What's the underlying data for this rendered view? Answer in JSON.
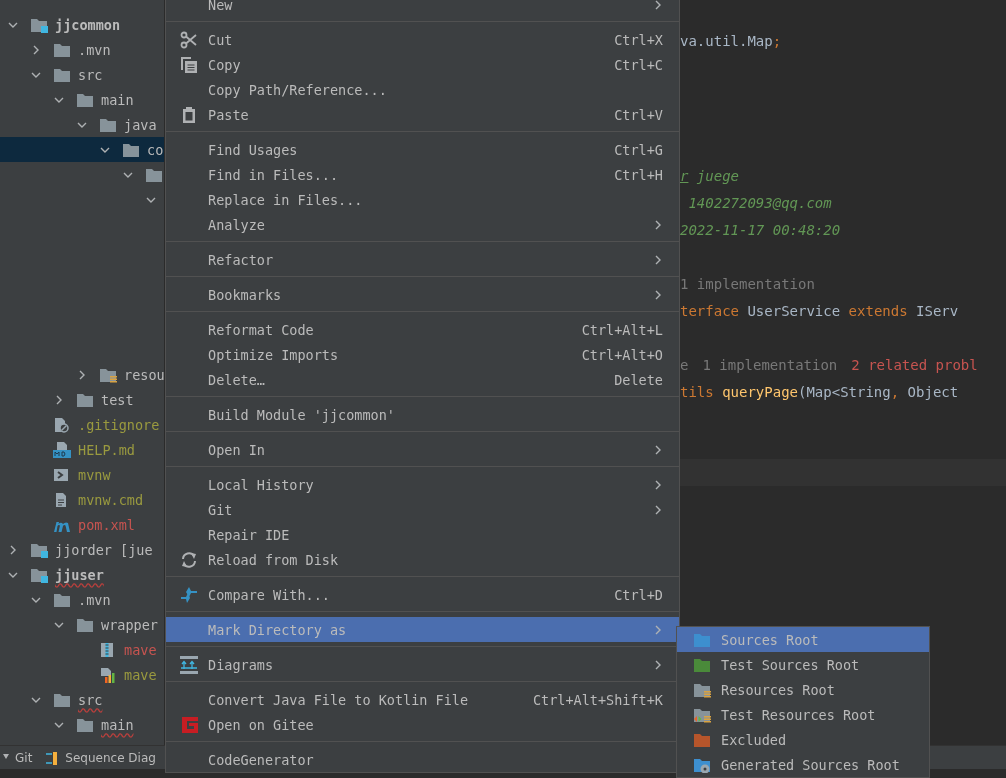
{
  "tree": [
    {
      "label": "jjcommon",
      "kind": "module",
      "bold": true,
      "expanded": true,
      "selected": false,
      "has_errors": false,
      "children": [
        {
          "label": ".mvn",
          "kind": "folder",
          "expanded": false,
          "selected": false,
          "has_errors": false
        },
        {
          "label": "src",
          "kind": "folder",
          "expanded": true,
          "selected": false,
          "has_errors": false,
          "children": [
            {
              "label": "main",
              "kind": "folder",
              "expanded": true,
              "selected": false,
              "has_errors": false,
              "children": [
                {
                  "label": "java",
                  "kind": "folder",
                  "expanded": true,
                  "selected": false,
                  "has_errors": false,
                  "children": [
                    {
                      "label": "co",
                      "kind": "folder",
                      "expanded": true,
                      "selected": true,
                      "children": [
                        {
                          "kind": "folder",
                          "expanded": true,
                          "selected": false,
                          "children": [
                            {
                              "expanded": true,
                              "selected": false
                            }
                          ]
                        }
                      ]
                    }
                  ]
                },
                {
                  "label": "resou",
                  "kind": "resources",
                  "expanded": false,
                  "selected": false,
                  "has_errors": false
                }
              ]
            },
            {
              "label": "test",
              "kind": "folder",
              "expanded": false,
              "selected": false,
              "has_errors": false
            }
          ]
        },
        {
          "label": ".gitignore",
          "kind": "ignore-file",
          "color": "#9a9a3f",
          "selected": false,
          "has_errors": false
        },
        {
          "label": "HELP.md",
          "kind": "markdown",
          "color": "#9a9a3f",
          "selected": false,
          "has_errors": false
        },
        {
          "label": "mvnw",
          "kind": "script",
          "color": "#9a9a3f",
          "selected": false,
          "has_errors": false
        },
        {
          "label": "mvnw.cmd",
          "kind": "text-file",
          "color": "#9a9a3f",
          "selected": false,
          "has_errors": false
        },
        {
          "label": "pom.xml",
          "kind": "maven",
          "color": "#c75450",
          "selected": false,
          "has_errors": false
        }
      ]
    },
    {
      "label": "jjorder [jue",
      "kind": "module",
      "bold": false,
      "expanded": false,
      "selected": false,
      "has_errors": false
    },
    {
      "label": "jjuser",
      "kind": "module",
      "bold": true,
      "expanded": true,
      "selected": false,
      "has_errors": true,
      "children": [
        {
          "label": ".mvn",
          "kind": "folder",
          "expanded": true,
          "selected": false,
          "has_errors": false,
          "children": [
            {
              "label": "wrapper",
              "kind": "folder",
              "expanded": true,
              "selected": false,
              "has_errors": false,
              "children": [
                {
                  "label": "mave",
                  "kind": "archive",
                  "color": "#c75450",
                  "selected": false,
                  "has_errors": false
                },
                {
                  "label": "mave",
                  "kind": "properties",
                  "color": "#9a9a3f",
                  "selected": false,
                  "has_errors": false
                }
              ]
            }
          ]
        },
        {
          "label": "src",
          "kind": "folder",
          "expanded": true,
          "selected": false,
          "has_errors": true,
          "children": [
            {
              "label": "main",
              "kind": "folder",
              "expanded": true,
              "selected": false,
              "has_errors": true
            }
          ]
        }
      ]
    }
  ],
  "editor": {
    "lines": [
      {
        "kind": "blank"
      },
      {
        "kind": "code",
        "segments": [
          {
            "text": "va.util.Map",
            "kind": "plain"
          },
          {
            "text": ";",
            "kind": "keyword"
          }
        ]
      },
      {
        "kind": "blank"
      },
      {
        "kind": "blank"
      },
      {
        "kind": "blank"
      },
      {
        "kind": "blank"
      },
      {
        "kind": "code",
        "segments": [
          {
            "text": "r",
            "kind": "doc-tag"
          },
          {
            "text": " juege",
            "kind": "comment"
          }
        ]
      },
      {
        "kind": "code",
        "segments": [
          {
            "text": " 1402272093@qq.com",
            "kind": "comment"
          }
        ]
      },
      {
        "kind": "code",
        "segments": [
          {
            "text": "2022-11-17 00:48:20",
            "kind": "comment"
          }
        ]
      },
      {
        "kind": "blank"
      },
      {
        "kind": "hint",
        "segments": [
          {
            "text": "1 implementation",
            "kind": "hint"
          }
        ]
      },
      {
        "kind": "code",
        "segments": [
          {
            "text": "terface",
            "kind": "keyword"
          },
          {
            "text": " UserService ",
            "kind": "plain"
          },
          {
            "text": "extends",
            "kind": "keyword"
          },
          {
            "text": " IServ",
            "kind": "plain"
          }
        ]
      },
      {
        "kind": "blank"
      },
      {
        "kind": "hint",
        "segments": [
          {
            "text": "e",
            "kind": "hint"
          },
          {
            "text": "1 implementation",
            "kind": "hint"
          },
          {
            "text": "2 related probl",
            "kind": "error"
          }
        ]
      },
      {
        "kind": "code",
        "segments": [
          {
            "text": "tils",
            "kind": "keyword"
          },
          {
            "text": " queryPage",
            "kind": "method"
          },
          {
            "text": "(Map<String",
            "kind": "plain"
          },
          {
            "text": ",",
            "kind": "keyword"
          },
          {
            "text": " Object",
            "kind": "plain"
          }
        ]
      },
      {
        "kind": "blank"
      },
      {
        "kind": "blank"
      },
      {
        "kind": "blank",
        "current": true
      }
    ]
  },
  "context_menu": {
    "items": [
      {
        "kind": "item",
        "label": "New",
        "submenu": true,
        "selected": false
      },
      {
        "kind": "separator"
      },
      {
        "kind": "cut",
        "label": "Cut",
        "shortcut": "Ctrl+X",
        "submenu": false,
        "selected": false
      },
      {
        "kind": "copy",
        "label": "Copy",
        "shortcut": "Ctrl+C",
        "submenu": false,
        "selected": false
      },
      {
        "kind": "item",
        "label": "Copy Path/Reference...",
        "submenu": false,
        "selected": false
      },
      {
        "kind": "paste",
        "label": "Paste",
        "shortcut": "Ctrl+V",
        "submenu": false,
        "selected": false
      },
      {
        "kind": "separator"
      },
      {
        "kind": "item",
        "label": "Find Usages",
        "shortcut": "Ctrl+G",
        "submenu": false,
        "selected": false
      },
      {
        "kind": "item",
        "label": "Find in Files...",
        "shortcut": "Ctrl+H",
        "submenu": false,
        "selected": false
      },
      {
        "kind": "item",
        "label": "Replace in Files...",
        "submenu": false,
        "selected": false
      },
      {
        "kind": "item",
        "label": "Analyze",
        "submenu": true,
        "selected": false
      },
      {
        "kind": "separator"
      },
      {
        "kind": "item",
        "label": "Refactor",
        "submenu": true,
        "selected": false
      },
      {
        "kind": "separator"
      },
      {
        "kind": "item",
        "label": "Bookmarks",
        "submenu": true,
        "selected": false
      },
      {
        "kind": "separator"
      },
      {
        "kind": "item",
        "label": "Reformat Code",
        "shortcut": "Ctrl+Alt+L",
        "submenu": false,
        "selected": false
      },
      {
        "kind": "item",
        "label": "Optimize Imports",
        "shortcut": "Ctrl+Alt+O",
        "submenu": false,
        "selected": false
      },
      {
        "kind": "item",
        "label": "Delete…",
        "shortcut": "Delete",
        "submenu": false,
        "selected": false
      },
      {
        "kind": "separator"
      },
      {
        "kind": "item",
        "label": "Build Module 'jjcommon'",
        "submenu": false,
        "selected": false
      },
      {
        "kind": "separator"
      },
      {
        "kind": "item",
        "label": "Open In",
        "submenu": true,
        "selected": false
      },
      {
        "kind": "separator"
      },
      {
        "kind": "item",
        "label": "Local History",
        "submenu": true,
        "selected": false
      },
      {
        "kind": "item",
        "label": "Git",
        "submenu": true,
        "selected": false
      },
      {
        "kind": "item",
        "label": "Repair IDE",
        "submenu": false,
        "selected": false
      },
      {
        "kind": "reload",
        "label": "Reload from Disk",
        "submenu": false,
        "selected": false
      },
      {
        "kind": "separator"
      },
      {
        "kind": "compare",
        "label": "Compare With...",
        "shortcut": "Ctrl+D",
        "submenu": false,
        "selected": false
      },
      {
        "kind": "separator"
      },
      {
        "kind": "item",
        "label": "Mark Directory as",
        "submenu": true,
        "selected": true
      },
      {
        "kind": "separator"
      },
      {
        "kind": "diagrams",
        "label": "Diagrams",
        "submenu": true,
        "selected": false
      },
      {
        "kind": "separator"
      },
      {
        "kind": "item",
        "label": "Convert Java File to Kotlin File",
        "shortcut": "Ctrl+Alt+Shift+K",
        "submenu": false,
        "selected": false
      },
      {
        "kind": "gitee",
        "label": "Open on Gitee",
        "submenu": false,
        "selected": false
      },
      {
        "kind": "separator"
      },
      {
        "kind": "item",
        "label": "CodeGenerator",
        "submenu": false,
        "selected": false
      }
    ]
  },
  "submenu": {
    "items": [
      {
        "label": "Sources Root",
        "kind": "sources",
        "selected": true
      },
      {
        "label": "Test Sources Root",
        "kind": "test-sources",
        "selected": false
      },
      {
        "label": "Resources Root",
        "kind": "resources",
        "selected": false
      },
      {
        "label": "Test Resources Root",
        "kind": "test-resources",
        "selected": false
      },
      {
        "label": "Excluded",
        "kind": "excluded",
        "selected": false
      },
      {
        "label": "Generated Sources Root",
        "kind": "generated",
        "selected": false
      }
    ]
  },
  "tool_window_bar": {
    "items": [
      {
        "label": "Git",
        "kind": "git"
      },
      {
        "label": "Sequence Diag",
        "kind": "sequence"
      }
    ]
  }
}
